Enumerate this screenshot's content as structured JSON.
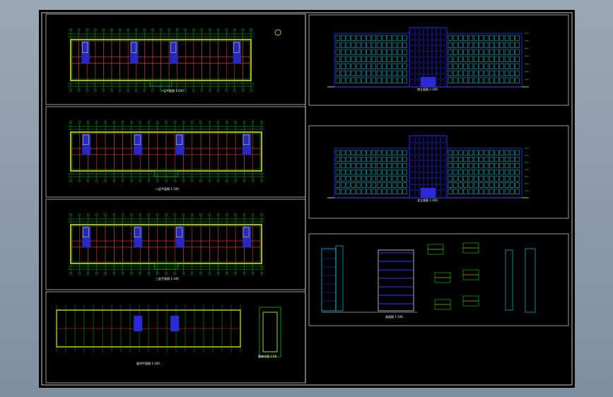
{
  "drawing": {
    "background": "#000000",
    "colors": {
      "frame": "#ffffff",
      "axis": "#00ff00",
      "wall": "#ffff00",
      "column": "#ff3030",
      "core": "#2a2ad8",
      "elevation": "#00e5ff",
      "elevation_dark": "#3030ff",
      "text": "#ffffff"
    },
    "floor_plans": [
      {
        "label": "一层平面图 1:100",
        "has_mark": true
      },
      {
        "label": "二层平面图 1:100",
        "has_mark": false
      },
      {
        "label": "三层平面图 1:100",
        "has_mark": false
      },
      {
        "label": "屋顶平面图 1:100",
        "has_mark": false
      }
    ],
    "elevations": [
      {
        "label": "南立面图 1:100"
      },
      {
        "label": "北立面图 1:100"
      }
    ],
    "details": {
      "label": "剖面图 1:100"
    },
    "roof_detail": {
      "label": "楼梯详图 1:50"
    }
  }
}
